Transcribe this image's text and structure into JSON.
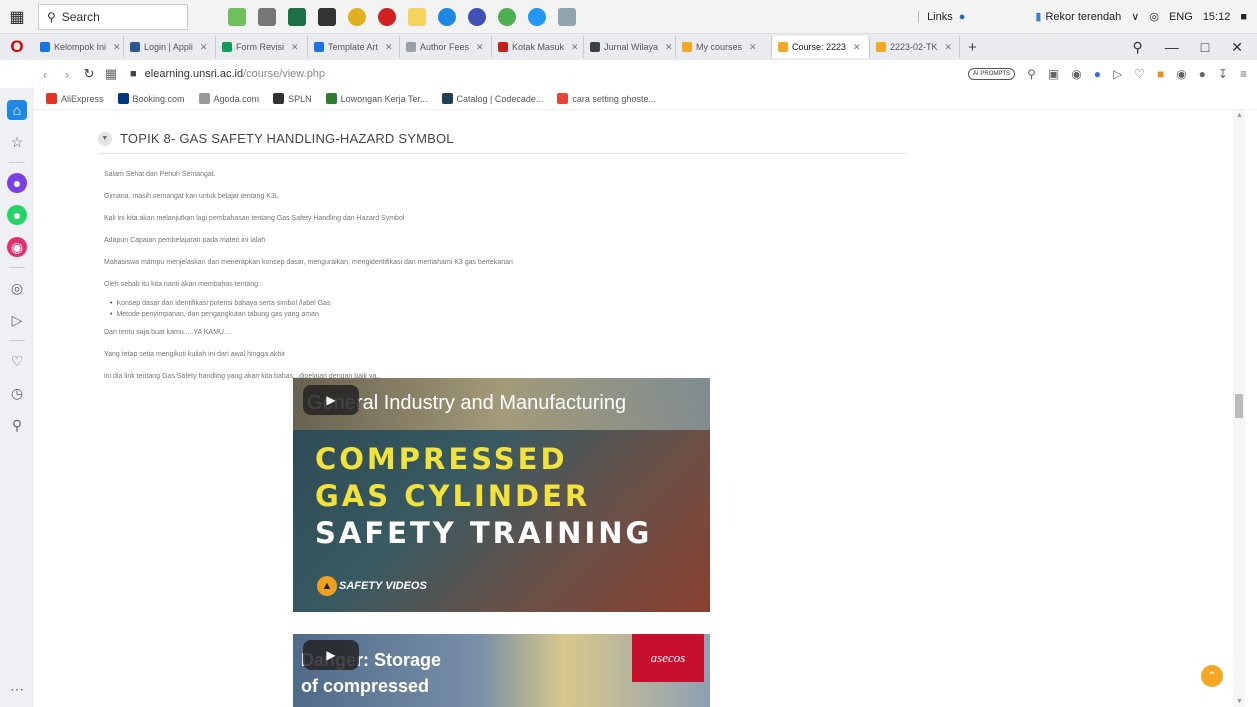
{
  "taskbar": {
    "search_placeholder": "Search",
    "links_label": "Links",
    "weather_text": "Rekor terendah",
    "lang": "ENG",
    "time": "15:12"
  },
  "browser": {
    "tabs": [
      {
        "label": "Kelompok Ini",
        "color": "#1a73e8"
      },
      {
        "label": "Login | Appli",
        "color": "#2b5797"
      },
      {
        "label": "Form Revisi",
        "color": "#0f9d58"
      },
      {
        "label": "Template Art",
        "color": "#1a73e8"
      },
      {
        "label": "Author Fees",
        "color": "#9aa0a6"
      },
      {
        "label": "Kotak Masuk",
        "color": "#c5221f"
      },
      {
        "label": "Jurnal Wilaya",
        "color": "#3c4043"
      },
      {
        "label": "My courses",
        "color": "#f5a623"
      },
      {
        "label": "Course: 2223",
        "color": "#f5a623",
        "active": true
      },
      {
        "label": "2223-02-TK",
        "color": "#f5a623"
      }
    ],
    "url_host": "elearning.unsri.ac.id",
    "url_path": "/course/view.php",
    "ai_badge": "AI PROMPTS",
    "bookmarks": [
      {
        "label": "AliExpress",
        "color": "#e43225"
      },
      {
        "label": "Booking.com",
        "color": "#003580"
      },
      {
        "label": "Agoda.com",
        "color": "#999999"
      },
      {
        "label": "SPLN",
        "color": "#333333"
      },
      {
        "label": "Lowongan Kerja Ter...",
        "color": "#2e7d32"
      },
      {
        "label": "Catalog | Codecade...",
        "color": "#1f4056"
      },
      {
        "label": "cara setting ghoste...",
        "color": "#ea4335"
      }
    ]
  },
  "topic": {
    "title": "TOPIK 8- GAS SAFETY HANDLING-HAZARD SYMBOL",
    "paragraphs": [
      "Salam Sehat dan Penuh Semangat.",
      "Gimana, masih semangat kan untuk belajar tentang K3L",
      "Kali ini kita akan melanjutkan lagi pembahasan tentang Gas Safety Handling dan Hazard Symbol",
      "Adapun Capaian pembelajaran pada materi ini ialah",
      "Mahasiswa mampu menjelaskan dan menerapkan konsep dasar, menguraikan, mengidentifikasi dan memahami K3 gas bertekanan",
      "Oleh sebab itu kita nanti akan membahas tentang :"
    ],
    "bullets": [
      "Konsep dasar dan identifikasi potensi bahaya serta simbol /label Gas",
      "Metode penyimpanan, dan pengangkutan tabung gas yang aman"
    ],
    "closing": [
      "Dan tentu saja buat kamu.... YA KAMU....",
      "Yang tetap setia mengikuti kuliah ini dari awal hingga akhir",
      "ini dia link tentang Gas Safety handling yang akan kita bahas...dipelajari dengan baik ya.."
    ]
  },
  "video1": {
    "top_title": "General Industry and Manufacturing",
    "line1": "COMPRESSED",
    "line2": "GAS CYLINDER",
    "line3": "SAFETY TRAINING",
    "logo": "SAFETY VIDEOS"
  },
  "video2": {
    "line1": "Danger: Storage",
    "line2": "of compressed",
    "brand": "asecos"
  }
}
